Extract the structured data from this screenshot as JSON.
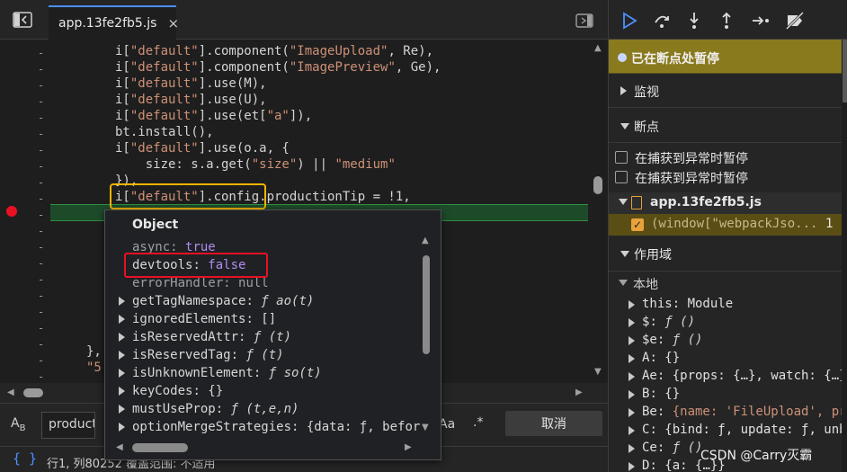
{
  "tab": {
    "filename": "app.13fe2fb5.js",
    "close": "×"
  },
  "code_lines": [
    {
      "pre": "i[",
      "str": "\"default\"",
      "mid": "].component(",
      "str2": "\"ImageUpload\"",
      "post": ", Re),"
    },
    {
      "pre": "i[",
      "str": "\"default\"",
      "mid": "].component(",
      "str2": "\"ImagePreview\"",
      "post": ", Ge),"
    },
    {
      "pre": "i[",
      "str": "\"default\"",
      "mid": "].use(M),",
      "str2": "",
      "post": ""
    },
    {
      "pre": "i[",
      "str": "\"default\"",
      "mid": "].use(U),",
      "str2": "",
      "post": ""
    },
    {
      "pre": "i[",
      "str": "\"default\"",
      "mid": "].use(et[",
      "str2": "\"a\"",
      "post": "]),"
    },
    {
      "pre": "bt.install(),",
      "str": "",
      "mid": "",
      "str2": "",
      "post": ""
    },
    {
      "pre": "i[",
      "str": "\"default\"",
      "mid": "].use(o.a, {",
      "str2": "",
      "post": ""
    },
    {
      "pre": "    size: s.a.get(",
      "str": "\"size\"",
      "mid": ") || ",
      "str2": "\"medium\"",
      "post": ""
    },
    {
      "pre": "}),",
      "str": "",
      "mid": "",
      "str2": "",
      "post": ""
    },
    {
      "pre": "i[",
      "str": "\"default\"",
      "mid": "].config.productionTip = !1,",
      "str2": "",
      "post": ""
    }
  ],
  "tail_lines": [
    "},",
    "\"5"
  ],
  "popover": {
    "title": "Object",
    "props": [
      {
        "key": "async",
        "sep": ": ",
        "val": "true",
        "kind": "bool",
        "expand": false,
        "dim": true
      },
      {
        "key": "devtools",
        "sep": ": ",
        "val": "false",
        "kind": "bool",
        "expand": false,
        "dim": false
      },
      {
        "key": "errorHandler",
        "sep": ": ",
        "val": "null",
        "kind": "null",
        "expand": false,
        "dim": true
      },
      {
        "key": "getTagNamespace",
        "sep": ": ",
        "val": "ƒ ao(t)",
        "kind": "fn",
        "expand": true,
        "dim": false
      },
      {
        "key": "ignoredElements",
        "sep": ": ",
        "val": "[]",
        "kind": "obj",
        "expand": true,
        "dim": false
      },
      {
        "key": "isReservedAttr",
        "sep": ": ",
        "val": "ƒ (t)",
        "kind": "fn",
        "expand": true,
        "dim": false
      },
      {
        "key": "isReservedTag",
        "sep": ": ",
        "val": "ƒ (t)",
        "kind": "fn",
        "expand": true,
        "dim": false
      },
      {
        "key": "isUnknownElement",
        "sep": ": ",
        "val": "ƒ so(t)",
        "kind": "fn",
        "expand": true,
        "dim": false
      },
      {
        "key": "keyCodes",
        "sep": ": ",
        "val": "{}",
        "kind": "obj",
        "expand": true,
        "dim": false
      },
      {
        "key": "mustUseProp",
        "sep": ": ",
        "val": "ƒ (t,e,n)",
        "kind": "fn",
        "expand": true,
        "dim": false
      },
      {
        "key": "optionMergeStrategies",
        "sep": ": ",
        "val": "{data: ƒ, befor",
        "kind": "obj",
        "expand": true,
        "dim": false
      }
    ]
  },
  "search": {
    "value": "productio",
    "aa_label": "Aa",
    "regex_label": ".*",
    "cancel": "取消"
  },
  "status": {
    "text": "行1, 列80252   覆盖范围: 不适用"
  },
  "debugger": {
    "paused_banner": "已在断点处暂停",
    "watch": "监视",
    "breakpoints": "断点",
    "pause_on_exceptions": [
      "在捕获到异常时暂停",
      "在捕获到异常时暂停"
    ],
    "bp_file": "app.13fe2fb5.js",
    "bp_snippet": "(window[\"webpackJso...",
    "bp_line": "1",
    "scope": "作用域",
    "local": "本地",
    "scope_items": [
      {
        "key": "this",
        "sep": ": ",
        "val": "Module",
        "kind": "obj"
      },
      {
        "key": "$",
        "sep": ": ",
        "val": "ƒ ()",
        "kind": "fn"
      },
      {
        "key": "$e",
        "sep": ": ",
        "val": "ƒ ()",
        "kind": "fn"
      },
      {
        "key": "A",
        "sep": ": ",
        "val": "{}",
        "kind": "obj"
      },
      {
        "key": "Ae",
        "sep": ": ",
        "val": "{props: {…}, watch: {…}",
        "kind": "obj"
      },
      {
        "key": "B",
        "sep": ": ",
        "val": "{}",
        "kind": "obj"
      },
      {
        "key": "Be",
        "sep": ": ",
        "val": "{name: 'FileUpload', pro",
        "kind": "mix"
      },
      {
        "key": "C",
        "sep": ": ",
        "val": "{bind: ƒ, update: ƒ, unbi",
        "kind": "obj"
      },
      {
        "key": "Ce",
        "sep": ": ",
        "val": "ƒ ()",
        "kind": "fn"
      },
      {
        "key": "D",
        "sep": ": ",
        "val": "{a: {…}}",
        "kind": "obj"
      }
    ]
  },
  "watermark": "CSDN @Carry灭霸",
  "colors": {
    "accent": "#4d90fe",
    "breakpoint": "#e81123",
    "paused_banner": "#8a7a1e",
    "highlight_box": "#f5b400"
  }
}
